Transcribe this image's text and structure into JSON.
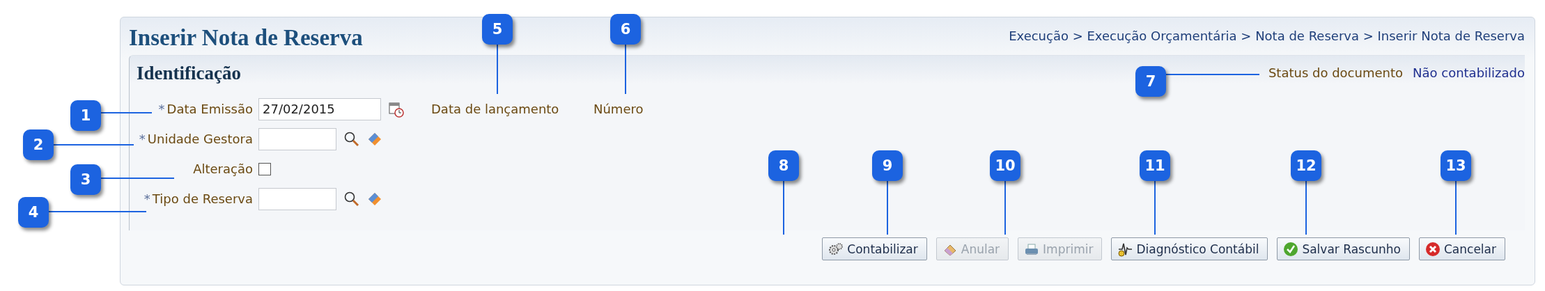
{
  "page": {
    "title": "Inserir Nota de Reserva",
    "breadcrumb": "Execução > Execução Orçamentária > Nota de Reserva > Inserir Nota de Reserva"
  },
  "section": {
    "title": "Identificação",
    "status_label": "Status do documento",
    "status_value": "Não contabilizado"
  },
  "fields": [
    {
      "kind": "date",
      "label": "Data Emissão",
      "required": true,
      "value": "27/02/2015"
    },
    {
      "kind": "lookup",
      "label": "Unidade Gestora",
      "required": true
    },
    {
      "kind": "checkbox",
      "label": "Alteração",
      "required": false,
      "checked": false
    },
    {
      "kind": "lookup",
      "label": "Tipo de Reserva",
      "required": true
    }
  ],
  "required_mark": "*",
  "info_labels": [
    "Data de lançamento",
    "Número"
  ],
  "buttons": [
    {
      "kind": "gear",
      "label": "Contabilizar",
      "disabled": false
    },
    {
      "kind": "eraser",
      "label": "Anular",
      "disabled": true
    },
    {
      "kind": "printer",
      "label": "Imprimir",
      "disabled": true
    },
    {
      "kind": "diagnostic",
      "label": "Diagnóstico Contábil",
      "disabled": false
    },
    {
      "kind": "check",
      "label": "Salvar Rascunho",
      "disabled": false
    },
    {
      "kind": "cancel",
      "label": "Cancelar",
      "disabled": false
    }
  ],
  "callouts": [
    {
      "label": "1"
    },
    {
      "label": "2"
    },
    {
      "label": "3"
    },
    {
      "label": "4"
    },
    {
      "label": "5"
    },
    {
      "label": "6"
    },
    {
      "label": "7"
    },
    {
      "label": "8"
    },
    {
      "label": "9"
    },
    {
      "label": "10"
    },
    {
      "label": "11"
    },
    {
      "label": "12"
    },
    {
      "label": "13"
    }
  ]
}
